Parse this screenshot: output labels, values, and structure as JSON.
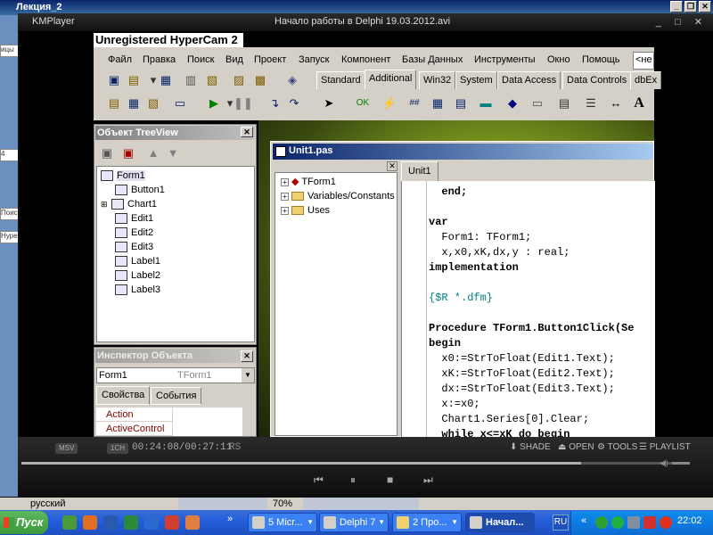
{
  "word_window": {
    "title": "Лекция_2",
    "lang_status": "русский",
    "zoom": "70%",
    "left_strip_labels": [
      "ицы",
      "4",
      "Поиск",
      "Hyper"
    ]
  },
  "kmplayer": {
    "app_name": "KMPlayer",
    "file_title": "Начало работы в Delphi 19.03.2012.avi",
    "window_controls": "_ □ ✕",
    "badge_left": "MSV",
    "badge_mid": "1CH",
    "time": "00:24:08/00:27:11",
    "rs": "RS",
    "options": [
      "SHADE",
      "OPEN",
      "TOOLS",
      "PLAYLIST"
    ],
    "seek_progress": 0.837,
    "playback_buttons": [
      "⏮",
      "⏸",
      "■",
      "⏭"
    ]
  },
  "hypercam_label": "Unregistered HyperCam 2",
  "delphi": {
    "menu": [
      "Файл",
      "Правка",
      "Поиск",
      "Вид",
      "Проект",
      "Запуск",
      "Компонент",
      "Базы Данных",
      "Инструменты",
      "Окно",
      "Помощь"
    ],
    "desktop_combo": "<не",
    "palette_tabs": [
      "Standard",
      "Additional",
      "Win32",
      "System",
      "Data Access",
      "Data Controls",
      "dbEx"
    ],
    "active_palette_tab": "Additional",
    "treeview": {
      "title": "Объект TreeView",
      "root": "Form1",
      "items": [
        "Button1",
        "Chart1",
        "Edit1",
        "Edit2",
        "Edit3",
        "Label1",
        "Label2",
        "Label3"
      ]
    },
    "inspector": {
      "title": "Инспектор Объекта",
      "object": "Form1",
      "class": "TForm1",
      "tabs": [
        "Свойства",
        "События"
      ],
      "properties": [
        "Action",
        "ActiveControl"
      ]
    },
    "editor": {
      "title": "Unit1.pas",
      "tab": "Unit1",
      "explorer": [
        "TForm1",
        "Variables/Constants",
        "Uses"
      ],
      "code_lines": [
        {
          "text": "  end;",
          "style": "kw"
        },
        {
          "text": "",
          "style": ""
        },
        {
          "text": "var",
          "style": "kw"
        },
        {
          "text": "  Form1: TForm1;",
          "style": ""
        },
        {
          "text": "  x,x0,xK,dx,y : real;",
          "style": ""
        },
        {
          "text": "implementation",
          "style": "kw"
        },
        {
          "text": "",
          "style": ""
        },
        {
          "text": "{$R *.dfm}",
          "style": "cm"
        },
        {
          "text": "",
          "style": ""
        },
        {
          "text": "Procedure TForm1.Button1Click(Se",
          "style": "kw"
        },
        {
          "text": "begin",
          "style": "kw"
        },
        {
          "text": "  x0:=StrToFloat(Edit1.Text);",
          "style": ""
        },
        {
          "text": "  xK:=StrToFloat(Edit2.Text);",
          "style": ""
        },
        {
          "text": "  dx:=StrToFloat(Edit3.Text);",
          "style": ""
        },
        {
          "text": "  x:=x0;",
          "style": ""
        },
        {
          "text": "  Chart1.Series[0].Clear;",
          "style": ""
        },
        {
          "text": "  while x<=xK do begin",
          "style": "kw"
        }
      ]
    }
  },
  "taskbar": {
    "start_label": "Пуск",
    "tasks": [
      {
        "label": "5 Micr...",
        "active": false
      },
      {
        "label": "Delphi 7",
        "active": false
      },
      {
        "label": "2 Про...",
        "active": false
      },
      {
        "label": "Начал...",
        "active": true
      }
    ],
    "lang": "RU",
    "clock": "22:02"
  }
}
